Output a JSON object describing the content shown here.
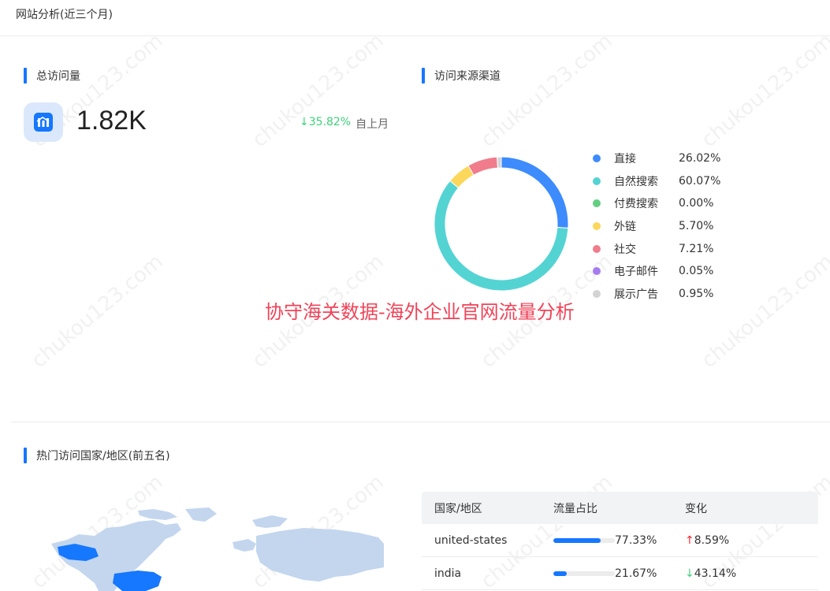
{
  "page": {
    "title": "网站分析(近三个月)"
  },
  "total_visits": {
    "title": "总访问量",
    "value": "1.82K",
    "change_pct": "↓35.82%",
    "change_label": "自上月",
    "icon": "chart-icon"
  },
  "traffic_sources": {
    "title": "访问来源渠道",
    "items": [
      {
        "name": "直接",
        "pct": "26.02%",
        "value": 26.02,
        "color": "#3d8bfd"
      },
      {
        "name": "自然搜索",
        "pct": "60.07%",
        "value": 60.07,
        "color": "#54d3d3"
      },
      {
        "name": "付费搜索",
        "pct": "0.00%",
        "value": 0.0,
        "color": "#62cf83"
      },
      {
        "name": "外链",
        "pct": "5.70%",
        "value": 5.7,
        "color": "#fbd75b"
      },
      {
        "name": "社交",
        "pct": "7.21%",
        "value": 7.21,
        "color": "#f07c8c"
      },
      {
        "name": "电子邮件",
        "pct": "0.05%",
        "value": 0.05,
        "color": "#a57cf0"
      },
      {
        "name": "展示广告",
        "pct": "0.95%",
        "value": 0.95,
        "color": "#d3d3d3"
      }
    ]
  },
  "overlay_text": "协守海关数据-海外企业官网流量分析",
  "top_countries": {
    "title": "热门访问国家/地区(前五名)",
    "columns": [
      "国家/地区",
      "流量占比",
      "变化"
    ],
    "rows": [
      {
        "country": "united-states",
        "share": "77.33%",
        "share_value": 77.33,
        "change": "8.59%",
        "direction": "up"
      },
      {
        "country": "india",
        "share": "21.67%",
        "share_value": 21.67,
        "change": "43.14%",
        "direction": "down"
      }
    ]
  },
  "watermark": "chukou123.com",
  "chart_data": {
    "type": "pie",
    "title": "访问来源渠道",
    "categories": [
      "直接",
      "自然搜索",
      "付费搜索",
      "外链",
      "社交",
      "电子邮件",
      "展示广告"
    ],
    "values": [
      26.02,
      60.07,
      0.0,
      5.7,
      7.21,
      0.05,
      0.95
    ],
    "legend_placement": "right"
  }
}
